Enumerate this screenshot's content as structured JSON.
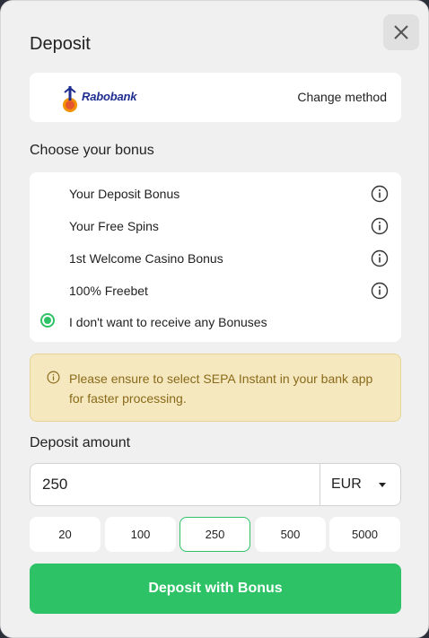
{
  "modal": {
    "title": "Deposit",
    "close_icon": "close-icon"
  },
  "payment_method": {
    "bank_name": "Rabobank",
    "logo_icon": "rabobank-logo",
    "change_label": "Change method"
  },
  "bonus": {
    "heading": "Choose your bonus",
    "options": [
      {
        "label": "Your Deposit Bonus",
        "icon": "info-icon",
        "selected": false
      },
      {
        "label": "Your Free Spins",
        "icon": "info-icon",
        "selected": false
      },
      {
        "label": "1st Welcome Casino Bonus",
        "icon": "info-icon",
        "selected": false
      },
      {
        "label": "100% Freebet",
        "icon": "info-icon",
        "selected": false
      },
      {
        "label": "I don't want to receive any Bonuses",
        "selected": true
      }
    ]
  },
  "notice": {
    "icon": "info-icon",
    "text": "Please ensure to select SEPA Instant in your bank app for faster processing."
  },
  "amount": {
    "heading": "Deposit amount",
    "value": "250",
    "currency": "EUR",
    "presets": [
      "20",
      "100",
      "250",
      "500",
      "5000"
    ],
    "selected_preset": "250"
  },
  "submit": {
    "label": "Deposit with Bonus"
  },
  "colors": {
    "accent": "#2ec266",
    "notice_bg": "#f5e8bf",
    "notice_text": "#8a6a1a",
    "bank_blue": "#1e2d8f"
  }
}
